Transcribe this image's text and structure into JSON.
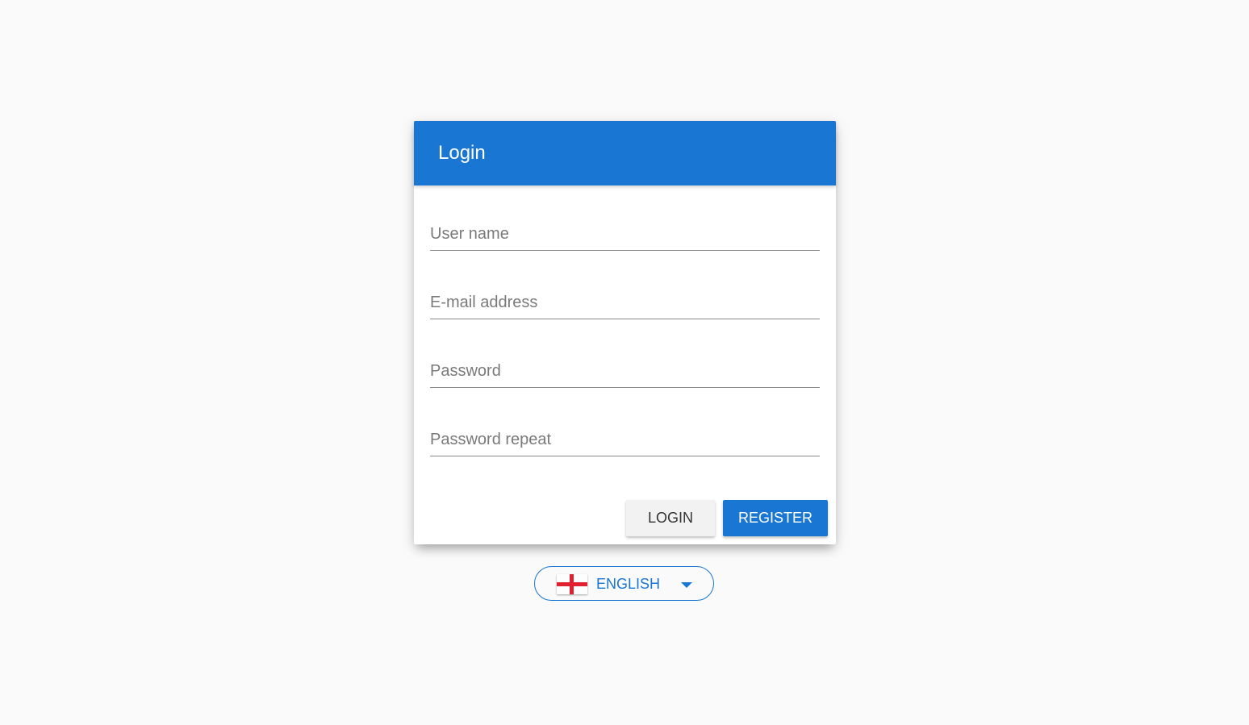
{
  "colors": {
    "primary": "#1976d2",
    "background": "#fafafa",
    "flag_red": "#e0202e"
  },
  "dialog": {
    "title": "Login",
    "fields": {
      "username": {
        "placeholder": "User name",
        "value": ""
      },
      "email": {
        "placeholder": "E-mail address",
        "value": ""
      },
      "password": {
        "placeholder": "Password",
        "value": ""
      },
      "password_repeat": {
        "placeholder": "Password repeat",
        "value": ""
      }
    },
    "buttons": {
      "login": "LOGIN",
      "register": "REGISTER"
    }
  },
  "language": {
    "selected": "ENGLISH",
    "flag_icon": "england-flag-icon",
    "dropdown_icon": "caret-down-icon"
  }
}
